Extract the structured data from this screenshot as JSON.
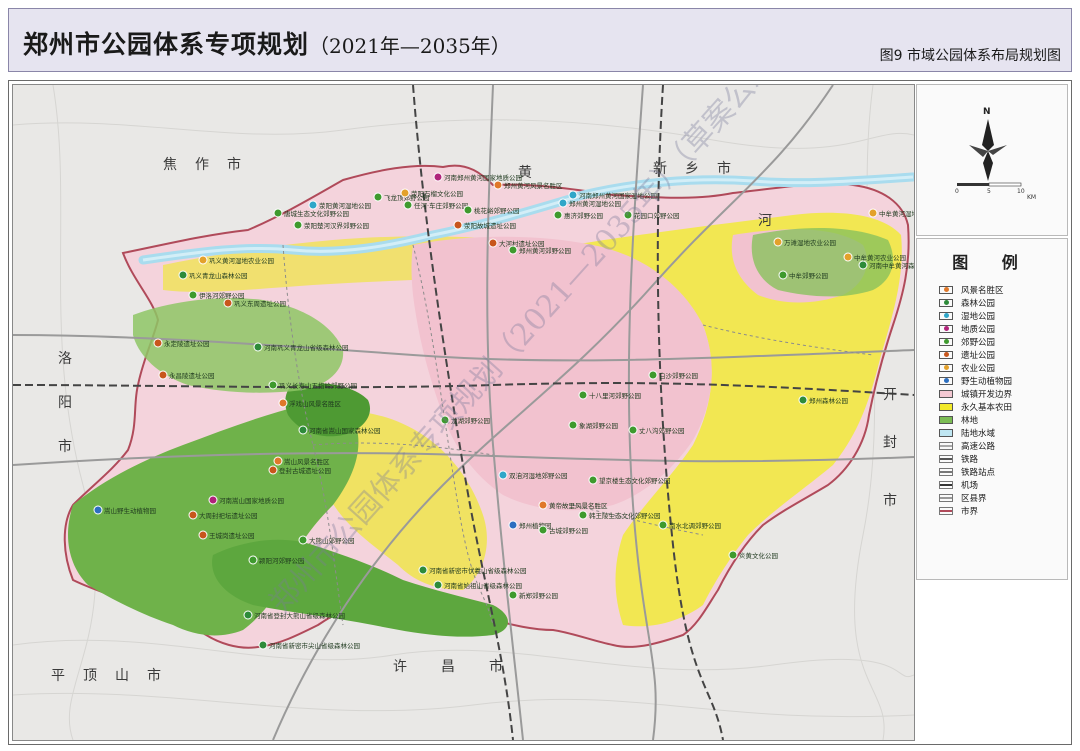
{
  "header": {
    "title": "郑州市公园体系专项规划",
    "years": "（2021年—2035年）",
    "figure_title": "图9  市域公园体系布局规划图"
  },
  "map": {
    "regions": [
      {
        "label": "焦　作　市"
      },
      {
        "label": "新　乡　市"
      },
      {
        "label": "洛"
      },
      {
        "label": "阳"
      },
      {
        "label": "市"
      },
      {
        "label": "开"
      },
      {
        "label": "封"
      },
      {
        "label": "市"
      },
      {
        "label": "平　顶　山　市"
      },
      {
        "label": "许　　昌　　市"
      },
      {
        "label": "黄"
      },
      {
        "label": "河"
      }
    ],
    "watermark": "郑州市公园体系专项规划（2021—2035年）（草案公示稿）",
    "parks": [
      {
        "name": "河南郑州黄河国家地质公园",
        "type": "geopark"
      },
      {
        "name": "郑州黄河风景名胜区",
        "type": "scenic"
      },
      {
        "name": "飞龙顶郊野公园",
        "type": "suburban"
      },
      {
        "name": "荥阳黄河湿地公园",
        "type": "wetland"
      },
      {
        "name": "荥阳石榴文化公园",
        "type": "agri"
      },
      {
        "name": "任河·车庄郊野公园",
        "type": "suburban"
      },
      {
        "name": "郑州黄河湿地公园",
        "type": "wetland"
      },
      {
        "name": "河南郑州黄河国家湿地公园",
        "type": "wetland"
      },
      {
        "name": "花园口郊野公园",
        "type": "suburban"
      },
      {
        "name": "惠济郊野公园",
        "type": "suburban"
      },
      {
        "name": "荥阳楚河汉界郊野公园",
        "type": "suburban"
      },
      {
        "name": "唐城生态文化郊野公园",
        "type": "suburban"
      },
      {
        "name": "桃花峪郊野公园",
        "type": "suburban"
      },
      {
        "name": "荥阳故城遗址公园",
        "type": "relic"
      },
      {
        "name": "大河村遗址公园",
        "type": "relic"
      },
      {
        "name": "郑州黄河郊野公园",
        "type": "suburban"
      },
      {
        "name": "中牟黄河湿地农业公园",
        "type": "agri"
      },
      {
        "name": "万滩湿地农业公园",
        "type": "agri"
      },
      {
        "name": "中牟黄河农业公园",
        "type": "agri"
      },
      {
        "name": "河南中牟黄河森林公园",
        "type": "forest"
      },
      {
        "name": "中牟郊野公园",
        "type": "suburban"
      },
      {
        "name": "巩义黄河湿地农业公园",
        "type": "agri"
      },
      {
        "name": "巩义青龙山森林公园",
        "type": "forest"
      },
      {
        "name": "伊洛河郊野公园",
        "type": "suburban"
      },
      {
        "name": "巩义东周遗址公园",
        "type": "relic"
      },
      {
        "name": "永定陵遗址公园",
        "type": "relic"
      },
      {
        "name": "永昌陵遗址公园",
        "type": "relic"
      },
      {
        "name": "河南巩义青龙山省级森林公园",
        "type": "forest"
      },
      {
        "name": "巩义长寿山五指岭郊野公园",
        "type": "suburban"
      },
      {
        "name": "浮戏山风景名胜区",
        "type": "scenic"
      },
      {
        "name": "河南省嵩山国家森林公园",
        "type": "forest"
      },
      {
        "name": "嵩山风景名胜区",
        "type": "scenic"
      },
      {
        "name": "河南嵩山国家地质公园",
        "type": "geopark"
      },
      {
        "name": "嵩山野生动植物园",
        "type": "zoo"
      },
      {
        "name": "登封古城遗址公园",
        "type": "relic"
      },
      {
        "name": "大周封祀坛遗址公园",
        "type": "relic"
      },
      {
        "name": "王城岗遗址公园",
        "type": "relic"
      },
      {
        "name": "颍阳河郊野公园",
        "type": "suburban"
      },
      {
        "name": "大熊山郊野公园",
        "type": "suburban"
      },
      {
        "name": "河南省登封大熊山省级森林公园",
        "type": "forest"
      },
      {
        "name": "河南省新密市尖山省级森林公园",
        "type": "forest"
      },
      {
        "name": "河南省新密市伏羲山省级森林公园",
        "type": "forest"
      },
      {
        "name": "河南省始祖山省级森林公园",
        "type": "forest"
      },
      {
        "name": "新郑郊野公园",
        "type": "suburban"
      },
      {
        "name": "郑州植物园",
        "type": "zoo"
      },
      {
        "name": "龙湖郊野公园",
        "type": "suburban"
      },
      {
        "name": "象湖郊野公园",
        "type": "suburban"
      },
      {
        "name": "白沙郊野公园",
        "type": "suburban"
      },
      {
        "name": "十八里河郊野公园",
        "type": "suburban"
      },
      {
        "name": "丈八沟郊野公园",
        "type": "suburban"
      },
      {
        "name": "郑州森林公园",
        "type": "forest"
      },
      {
        "name": "双洎河湿地郊野公园",
        "type": "wetland"
      },
      {
        "name": "望京楼生态文化郊野公园",
        "type": "suburban"
      },
      {
        "name": "韩王陵生态文化郊野公园",
        "type": "suburban"
      },
      {
        "name": "古城郊野公园",
        "type": "suburban"
      },
      {
        "name": "南水北调郊野公园",
        "type": "suburban"
      },
      {
        "name": "炎黄文化公园",
        "type": "suburban"
      },
      {
        "name": "黄帝故里风景名胜区",
        "type": "scenic"
      }
    ]
  },
  "compass": {
    "north": "N",
    "scale_ticks": [
      "0",
      "5",
      "10"
    ],
    "scale_unit": "KM"
  },
  "legend": {
    "title": "图 例",
    "items": [
      {
        "label": "风景名胜区",
        "kind": "point",
        "color": "#e0782a"
      },
      {
        "label": "森林公园",
        "kind": "point",
        "color": "#2e8b3a"
      },
      {
        "label": "湿地公园",
        "kind": "point",
        "color": "#2fa6c8"
      },
      {
        "label": "地质公园",
        "kind": "point",
        "color": "#b0237a"
      },
      {
        "label": "郊野公园",
        "kind": "point",
        "color": "#3f9a2e"
      },
      {
        "label": "遗址公园",
        "kind": "point",
        "color": "#c8561c"
      },
      {
        "label": "农业公园",
        "kind": "point",
        "color": "#e3a12b"
      },
      {
        "label": "野生动植物园",
        "kind": "point",
        "color": "#2d6fc0"
      },
      {
        "label": "城镇开发边界",
        "kind": "fill",
        "color": "#f3c8d2"
      },
      {
        "label": "永久基本农田",
        "kind": "fill",
        "color": "#f2ea2a"
      },
      {
        "label": "林地",
        "kind": "fill",
        "color": "#7cbd54"
      },
      {
        "label": "陆地水域",
        "kind": "fill",
        "color": "#bfe6f2"
      },
      {
        "label": "高速公路",
        "kind": "line",
        "color": "#aaaaaa"
      },
      {
        "label": "铁路",
        "kind": "line",
        "color": "#555555"
      },
      {
        "label": "铁路站点",
        "kind": "line",
        "color": "#777777"
      },
      {
        "label": "机场",
        "kind": "line",
        "color": "#333333"
      },
      {
        "label": "区县界",
        "kind": "line",
        "color": "#999999"
      },
      {
        "label": "市界",
        "kind": "line",
        "color": "#b04a5a"
      }
    ]
  }
}
